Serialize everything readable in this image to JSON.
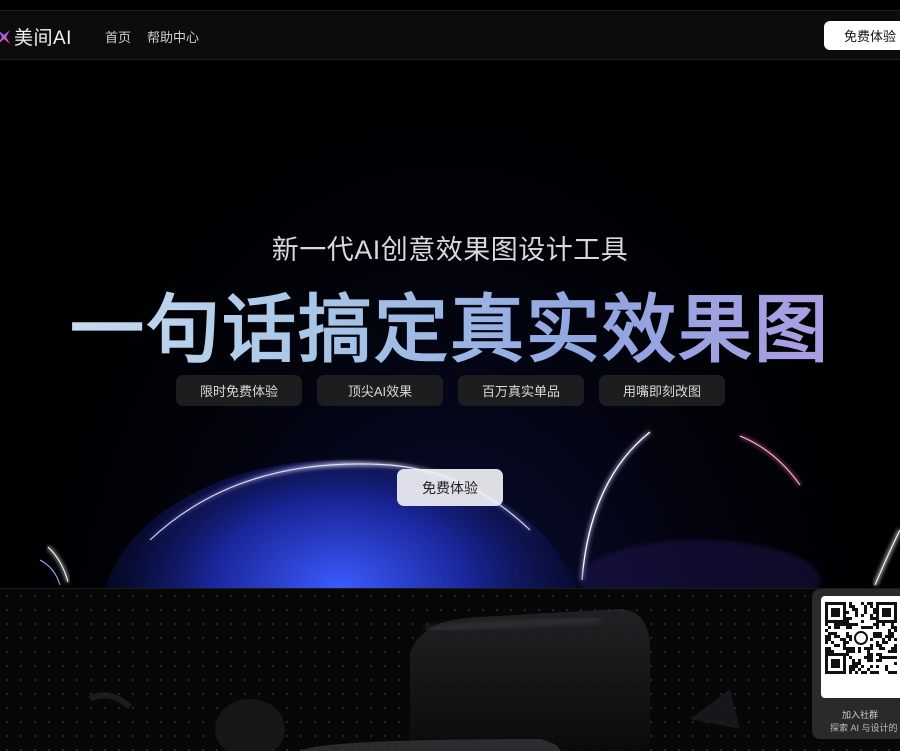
{
  "header": {
    "brand": "美间AI",
    "brand_icon": "star-logo-icon",
    "nav": [
      "首页",
      "帮助中心"
    ],
    "cta_label": "免费体验"
  },
  "hero": {
    "subtitle": "新一代AI创意效果图设计工具",
    "headline": "一句话搞定真实效果图",
    "tags": [
      "限时免费体验",
      "顶尖AI效果",
      "百万真实单品",
      "用嘴即刻改图"
    ],
    "cta_label": "免费体验"
  },
  "qr": {
    "icon": "qr-code-icon",
    "label": "加入社群",
    "sub": "探索 AI 与设计的"
  },
  "colors": {
    "background": "#000000",
    "headline_gradient": [
      "#cfe0f2",
      "#8fa6e0",
      "#b29ce3"
    ],
    "accent_blue": "#2d44ff"
  }
}
